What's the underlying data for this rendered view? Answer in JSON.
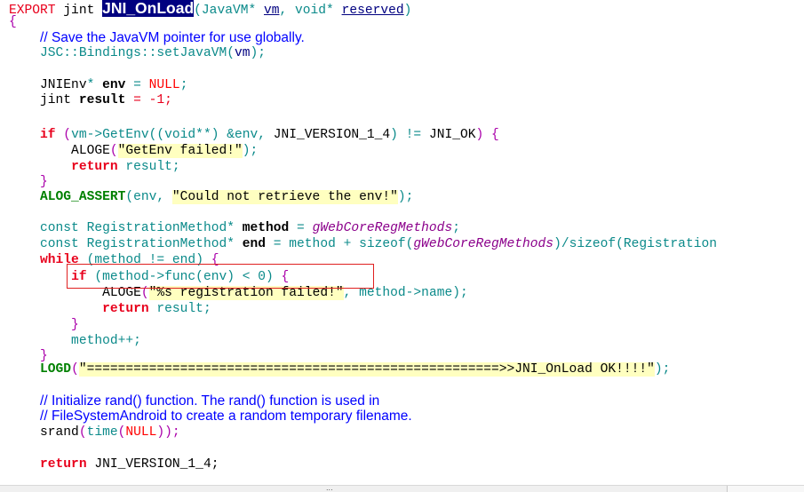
{
  "colors": {
    "keyword": "#e8001c",
    "type": "#0b8a8a",
    "string_bg": "#ffffc0",
    "comment": "#0000ff",
    "highlight_bg": "#000080",
    "macro": "#008000",
    "global": "#8b008b",
    "null": "#ff0000",
    "brace": "#aa00aa"
  },
  "code": {
    "lines": [
      {
        "tokens": [
          {
            "t": "EXPORT",
            "c": "#e8001c"
          },
          {
            "t": " jint ",
            "c": "#000000"
          },
          {
            "t": "JNI_OnLoad",
            "s": "fn"
          },
          {
            "t": "(JavaVM* ",
            "c": "#0b8a8a"
          },
          {
            "t": "vm",
            "c": "#000080",
            "s": "u"
          },
          {
            "t": ", void* ",
            "c": "#0b8a8a"
          },
          {
            "t": "reserved",
            "c": "#000080",
            "s": "u"
          },
          {
            "t": ")",
            "c": "#0b8a8a"
          }
        ]
      },
      {
        "tokens": [
          {
            "t": "{",
            "c": "#aa00aa"
          }
        ]
      },
      {
        "tokens": [
          {
            "t": "    ",
            "c": "#000000"
          },
          {
            "t": "// Save the JavaVM pointer for use globally.",
            "s": "comment"
          }
        ]
      },
      {
        "tokens": [
          {
            "t": "    JSC::Bindings::setJavaVM(",
            "c": "#0b8a8a"
          },
          {
            "t": "vm",
            "c": "#000080"
          },
          {
            "t": ");",
            "c": "#0b8a8a"
          }
        ]
      },
      {
        "tokens": []
      },
      {
        "tokens": [
          {
            "t": "    JNIEnv",
            "c": "#000000"
          },
          {
            "t": "* ",
            "c": "#0b8a8a"
          },
          {
            "t": "env",
            "c": "#000000",
            "s": "b"
          },
          {
            "t": " = ",
            "c": "#0b8a8a"
          },
          {
            "t": "NULL",
            "c": "#ff0000"
          },
          {
            "t": ";",
            "c": "#0b8a8a"
          }
        ]
      },
      {
        "tokens": [
          {
            "t": "    jint ",
            "c": "#000000"
          },
          {
            "t": "result",
            "c": "#000000",
            "s": "b"
          },
          {
            "t": " = -1;",
            "c": "#e8001c"
          }
        ]
      },
      {
        "tokens": []
      },
      {
        "tokens": [
          {
            "t": "    ",
            "c": "#000000"
          },
          {
            "t": "if",
            "c": "#e8001c",
            "s": "b"
          },
          {
            "t": " (",
            "c": "#aa00aa"
          },
          {
            "t": "vm->GetEnv((void**) &env, ",
            "c": "#0b8a8a"
          },
          {
            "t": "JNI_VERSION_1_4",
            "c": "#000000"
          },
          {
            "t": ") != ",
            "c": "#0b8a8a"
          },
          {
            "t": "JNI_OK",
            "c": "#000000"
          },
          {
            "t": ")",
            "c": "#aa00aa"
          },
          {
            "t": " {",
            "c": "#aa00aa"
          }
        ]
      },
      {
        "tokens": [
          {
            "t": "        ALOGE",
            "c": "#000000"
          },
          {
            "t": "(",
            "c": "#aa00aa"
          },
          {
            "t": "\"GetEnv failed!\"",
            "c": "#000000",
            "s": "str"
          },
          {
            "t": ");",
            "c": "#0b8a8a"
          }
        ]
      },
      {
        "tokens": [
          {
            "t": "        ",
            "c": "#000000"
          },
          {
            "t": "return",
            "c": "#e8001c",
            "s": "b"
          },
          {
            "t": " result;",
            "c": "#0b8a8a"
          }
        ]
      },
      {
        "tokens": [
          {
            "t": "    }",
            "c": "#aa00aa"
          }
        ]
      },
      {
        "tokens": [
          {
            "t": "    ALOG_ASSERT",
            "c": "#008000",
            "s": "b"
          },
          {
            "t": "(env, ",
            "c": "#0b8a8a"
          },
          {
            "t": "\"Could not retrieve the env!\"",
            "c": "#000000",
            "s": "str"
          },
          {
            "t": ");",
            "c": "#0b8a8a"
          }
        ]
      },
      {
        "tokens": []
      },
      {
        "tokens": [
          {
            "t": "    const RegistrationMethod* ",
            "c": "#0b8a8a"
          },
          {
            "t": "method",
            "c": "#000000",
            "s": "b"
          },
          {
            "t": " = ",
            "c": "#0b8a8a"
          },
          {
            "t": "gWebCoreRegMethods",
            "c": "#8b008b",
            "s": "i"
          },
          {
            "t": ";",
            "c": "#0b8a8a"
          }
        ]
      },
      {
        "tokens": [
          {
            "t": "    const RegistrationMethod* ",
            "c": "#0b8a8a"
          },
          {
            "t": "end",
            "c": "#000000",
            "s": "b"
          },
          {
            "t": " = method + sizeof(",
            "c": "#0b8a8a"
          },
          {
            "t": "gWebCoreRegMethods",
            "c": "#8b008b",
            "s": "i"
          },
          {
            "t": ")/sizeof(Registration",
            "c": "#0b8a8a"
          }
        ]
      },
      {
        "tokens": [
          {
            "t": "    ",
            "c": "#000000"
          },
          {
            "t": "while",
            "c": "#e8001c",
            "s": "b"
          },
          {
            "t": " (method != end) ",
            "c": "#0b8a8a"
          },
          {
            "t": "{",
            "c": "#aa00aa"
          }
        ]
      },
      {
        "tokens": [
          {
            "t": "        ",
            "c": "#000000"
          },
          {
            "t": "if",
            "c": "#e8001c",
            "s": "b"
          },
          {
            "t": " (method->func(env) < 0) ",
            "c": "#0b8a8a"
          },
          {
            "t": "{",
            "c": "#aa00aa"
          }
        ]
      },
      {
        "tokens": [
          {
            "t": "            ALOGE",
            "c": "#000000"
          },
          {
            "t": "(",
            "c": "#aa00aa"
          },
          {
            "t": "\"%s registration failed!\"",
            "c": "#000000",
            "s": "str"
          },
          {
            "t": ", method->name);",
            "c": "#0b8a8a"
          }
        ]
      },
      {
        "tokens": [
          {
            "t": "            ",
            "c": "#000000"
          },
          {
            "t": "return",
            "c": "#e8001c",
            "s": "b"
          },
          {
            "t": " result;",
            "c": "#0b8a8a"
          }
        ]
      },
      {
        "tokens": [
          {
            "t": "        }",
            "c": "#aa00aa"
          }
        ]
      },
      {
        "tokens": [
          {
            "t": "        method++;",
            "c": "#0b8a8a"
          }
        ]
      },
      {
        "tokens": [
          {
            "t": "    }",
            "c": "#aa00aa"
          }
        ]
      },
      {
        "tokens": [
          {
            "t": "    LOGD",
            "c": "#008000",
            "s": "b"
          },
          {
            "t": "(",
            "c": "#aa00aa"
          },
          {
            "t": "\"=====================================================>>JNI_OnLoad OK!!!!\"",
            "c": "#000000",
            "s": "str"
          },
          {
            "t": ");",
            "c": "#0b8a8a"
          }
        ]
      },
      {
        "tokens": []
      },
      {
        "tokens": [
          {
            "t": "    ",
            "c": "#000000"
          },
          {
            "t": "// Initialize rand() function. The rand() function is used in",
            "s": "comment"
          }
        ]
      },
      {
        "tokens": [
          {
            "t": "    ",
            "c": "#000000"
          },
          {
            "t": "// FileSystemAndroid to create a random temporary filename.",
            "s": "comment"
          }
        ]
      },
      {
        "tokens": [
          {
            "t": "    srand",
            "c": "#000000"
          },
          {
            "t": "(",
            "c": "#aa00aa"
          },
          {
            "t": "time",
            "c": "#0b8a8a"
          },
          {
            "t": "(",
            "c": "#aa00aa"
          },
          {
            "t": "NULL",
            "c": "#ff0000"
          },
          {
            "t": "));",
            "c": "#aa00aa"
          }
        ]
      },
      {
        "tokens": []
      },
      {
        "tokens": [
          {
            "t": "    ",
            "c": "#000000"
          },
          {
            "t": "return",
            "c": "#e8001c",
            "s": "b"
          },
          {
            "t": " JNI_VERSION_1_4;",
            "c": "#000000"
          }
        ]
      }
    ]
  },
  "scrollbar": {
    "grip_glyph": "..."
  }
}
